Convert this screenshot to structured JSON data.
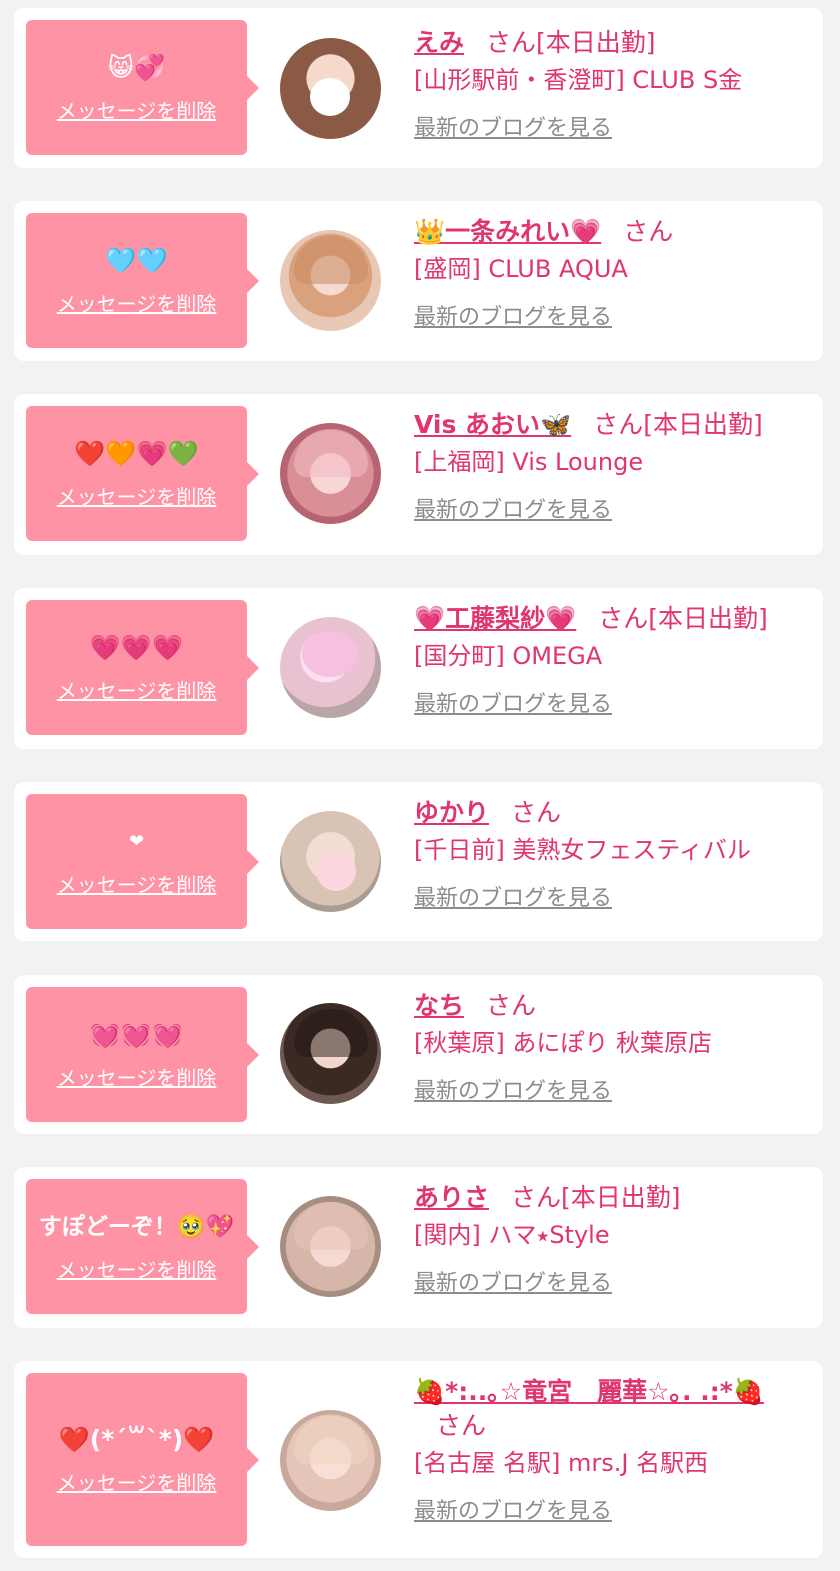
{
  "delete_label": "メッセージを削除",
  "blog_label": "最新のブログを見る",
  "san": "さん",
  "today": "[本日出勤]",
  "colors": {
    "bubble": "#ff93a6",
    "accent": "#e0356d",
    "muted": "#8c8c8c",
    "card": "#ffffff",
    "background": "#f2f2f2"
  },
  "items": [
    {
      "message": "😸💞",
      "name": "えみ",
      "status": "[本日出勤]",
      "shop": "[山形駅前・香澄町] CLUB S金",
      "avatar": "avatar-photo-1"
    },
    {
      "message": "🩵🩵",
      "name": "👑一条みれい💗",
      "status": "",
      "shop": "[盛岡] CLUB AQUA",
      "avatar": "avatar-photo-2"
    },
    {
      "message": "❤️🧡💗💚",
      "name": "Vis あおい🦋",
      "status": "[本日出勤]",
      "shop": "[上福岡] Vis Lounge",
      "avatar": "avatar-photo-3"
    },
    {
      "message": "💗💗💗",
      "name": "💗工藤梨紗💗",
      "status": "[本日出勤]",
      "shop": "[国分町] OMEGA",
      "avatar": "avatar-photo-4"
    },
    {
      "message": "❤",
      "name": "ゆかり",
      "status": "",
      "shop": "[千日前] 美熟女フェスティバル",
      "avatar": "avatar-photo-5"
    },
    {
      "message": "💓💓💓",
      "name": "なち",
      "status": "",
      "shop": "[秋葉原] あにぽり 秋葉原店",
      "avatar": "avatar-photo-6"
    },
    {
      "message": "すぽどーぞ！🥹💖",
      "name": "ありさ",
      "status": "[本日出勤]",
      "shop": "[関内] ハマ⭑Style",
      "avatar": "avatar-photo-7"
    },
    {
      "message": "❤️(*´꒳`*)❤️",
      "name": "🍓*:..｡☆竜宮　麗華☆｡. .:*🍓",
      "status": "",
      "shop": "[名古屋 名駅] mrs.J 名駅西",
      "avatar": "avatar-photo-8"
    }
  ]
}
